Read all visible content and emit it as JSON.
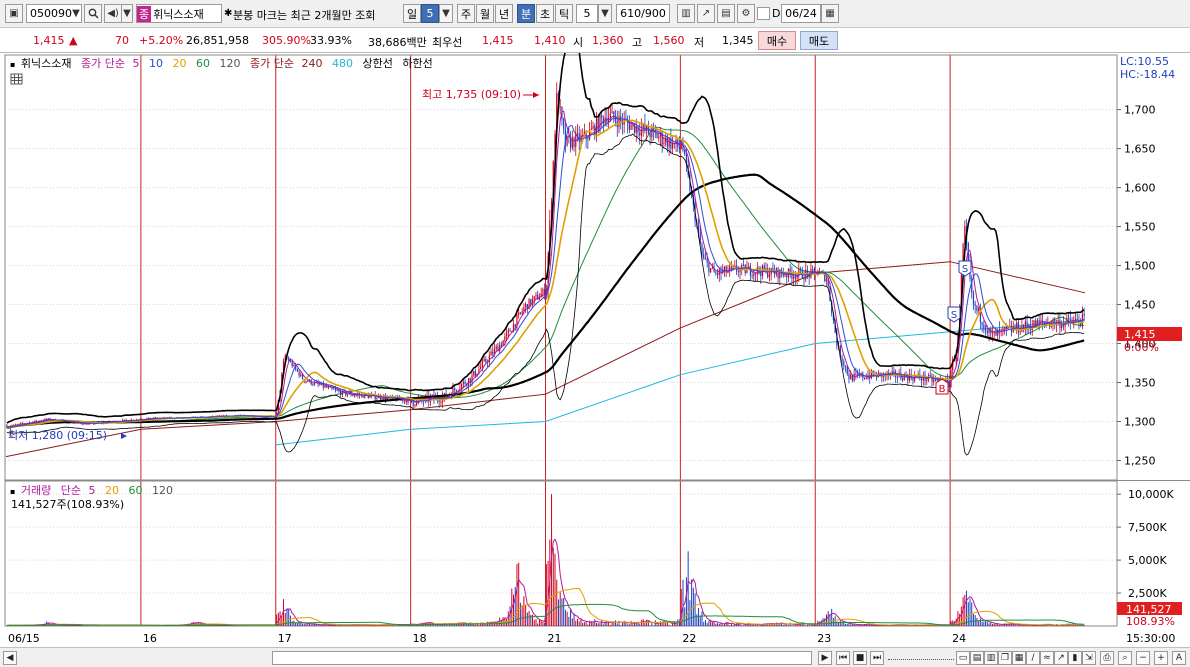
{
  "toolbar": {
    "code": "050090",
    "stock_tag": "종",
    "stock_name": "휘닉스소재",
    "notice": "분봉 마크는 최근 2개월만 조회",
    "periods": [
      "일",
      "5",
      "주",
      "월",
      "년",
      "분",
      "초",
      "틱"
    ],
    "period_selected": [
      "일",
      "분"
    ],
    "interval": "5",
    "count": "610/900",
    "checkbox_label": "D",
    "date": "06/24"
  },
  "quote": {
    "price": "1,415",
    "change_arrow": "▲",
    "change": "70",
    "change_pct": "+5.20%",
    "volume": "26,851,958",
    "volume_ratio": "305.90%",
    "turnover": "33.93%",
    "amount": "38,686백만",
    "best_label": "최우선",
    "best_ask": "1,415",
    "best_bid": "1,410",
    "open_label": "시",
    "open": "1,360",
    "high_label": "고",
    "high": "1,560",
    "low_label": "저",
    "low": "1,345",
    "buy_label": "매수",
    "sell_label": "매도"
  },
  "legend": {
    "name": "휘닉스소재",
    "ma_label": "종가 단순",
    "ma_periods": [
      "5",
      "10",
      "20",
      "60",
      "120"
    ],
    "ma2_label": "종가 단순",
    "ma2_periods": [
      "240",
      "480"
    ],
    "upper_band": "상한선",
    "lower_band": "하한선",
    "lc": "LC:10.55",
    "hc": "HC:-18.44"
  },
  "annotations": {
    "high": "최고 1,735 (09:10)",
    "low": "최저 1,280 (09:15)",
    "signals": [
      "S",
      "S",
      "B"
    ]
  },
  "price_marker": {
    "value": "1,415",
    "pct": "0.00%"
  },
  "volume_legend": {
    "label": "거래량",
    "ma_label": "단순",
    "periods": [
      "5",
      "20",
      "60",
      "120"
    ],
    "current": "141,527주(108.93%)"
  },
  "volume_marker": {
    "value": "141,527",
    "pct": "108.93%"
  },
  "time_label": "15:30:00",
  "colors": {
    "up": "#d0021b",
    "down": "#1f3fbf",
    "ma5": "#b0199a",
    "ma10": "#2b4cd1",
    "ma20": "#e0a000",
    "ma60": "#1e8f3c",
    "ma120": "#8c8c8c",
    "ma240": "#8b1a1a",
    "ma480": "#20b8e0",
    "band": "#000000",
    "day_divider": "#cc2222",
    "grid": "#d8d8d8"
  },
  "chart_data": [
    {
      "type": "candlestick",
      "name": "price",
      "x_ticks": [
        "06/15",
        "16",
        "17",
        "18",
        "21",
        "22",
        "23",
        "24"
      ],
      "y_ticks": [
        1250,
        1300,
        1350,
        1400,
        1450,
        1500,
        1550,
        1600,
        1650,
        1700
      ],
      "ylim": [
        1225,
        1770
      ],
      "sessions": [
        {
          "day": "06/15",
          "open": 1295,
          "high": 1318,
          "low": 1280,
          "close": 1305
        },
        {
          "day": "16",
          "open": 1305,
          "high": 1318,
          "low": 1292,
          "close": 1310
        },
        {
          "day": "17",
          "open": 1310,
          "high": 1390,
          "low": 1300,
          "close": 1330
        },
        {
          "day": "18",
          "open": 1325,
          "high": 1480,
          "low": 1315,
          "close": 1465
        },
        {
          "day": "21",
          "open": 1470,
          "high": 1735,
          "low": 1455,
          "close": 1655
        },
        {
          "day": "22",
          "open": 1650,
          "high": 1665,
          "low": 1465,
          "close": 1490
        },
        {
          "day": "23",
          "open": 1485,
          "high": 1500,
          "low": 1340,
          "close": 1345
        },
        {
          "day": "24",
          "open": 1360,
          "high": 1560,
          "low": 1345,
          "close": 1415
        }
      ],
      "overlays": [
        {
          "name": "MA5",
          "color": "ma5"
        },
        {
          "name": "MA10",
          "color": "ma10"
        },
        {
          "name": "MA20",
          "color": "ma20"
        },
        {
          "name": "MA60",
          "color": "ma60"
        },
        {
          "name": "MA120",
          "color": "ma120"
        },
        {
          "name": "MA240",
          "color": "ma240",
          "values": [
            1255,
            1290,
            1300,
            1315,
            1335,
            1420,
            1490,
            1505,
            1465
          ]
        },
        {
          "name": "MA480",
          "color": "ma480",
          "values": [
            null,
            null,
            1270,
            1290,
            1300,
            1360,
            1400,
            1415,
            1430
          ]
        }
      ]
    },
    {
      "type": "bar",
      "name": "volume",
      "y_ticks": [
        "2,500K",
        "5,000K",
        "7,500K",
        "10,000K"
      ],
      "ylim": [
        0,
        11000
      ],
      "sessions": [
        "06/15",
        "16",
        "17",
        "18",
        "21",
        "22",
        "23",
        "24"
      ],
      "peaks_k": [
        250,
        300,
        2000,
        4800,
        10000,
        5000,
        1500,
        2800
      ]
    }
  ]
}
